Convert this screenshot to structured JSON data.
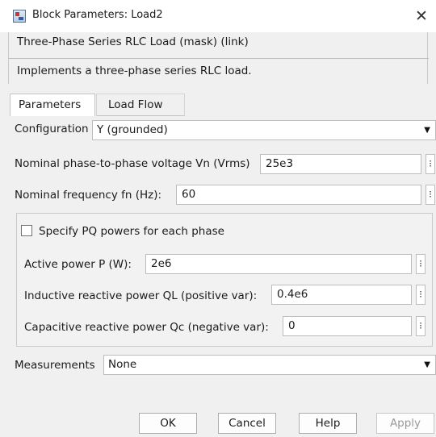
{
  "window": {
    "title": "Block Parameters: Load2",
    "close_glyph": "✕"
  },
  "description": {
    "title": "Three-Phase Series RLC Load (mask) (link)",
    "text": "Implements a three-phase series RLC load."
  },
  "tabs": [
    {
      "label": "Parameters",
      "active": true
    },
    {
      "label": "Load Flow",
      "active": false
    }
  ],
  "fields": {
    "configuration": {
      "label": "Configuration",
      "value": "Y (grounded)"
    },
    "nominal_voltage": {
      "label": "Nominal phase-to-phase voltage Vn (Vrms)",
      "value": "25e3"
    },
    "nominal_frequency": {
      "label": "Nominal frequency fn (Hz):",
      "value": "60"
    },
    "specify_pq": {
      "label": "Specify PQ powers for each phase",
      "checked": false
    },
    "active_power": {
      "label": "Active power P (W):",
      "value": "2e6"
    },
    "inductive_power": {
      "label": "Inductive reactive power QL (positive var):",
      "value": "0.4e6"
    },
    "capacitive_power": {
      "label": "Capacitive reactive power Qc (negative var):",
      "value": "0"
    },
    "measurements": {
      "label": "Measurements",
      "value": "None"
    }
  },
  "buttons": {
    "ok": "OK",
    "cancel": "Cancel",
    "help": "Help",
    "apply": "Apply"
  },
  "icons": {
    "menu_glyph": "⁝",
    "caret_glyph": "▼"
  }
}
